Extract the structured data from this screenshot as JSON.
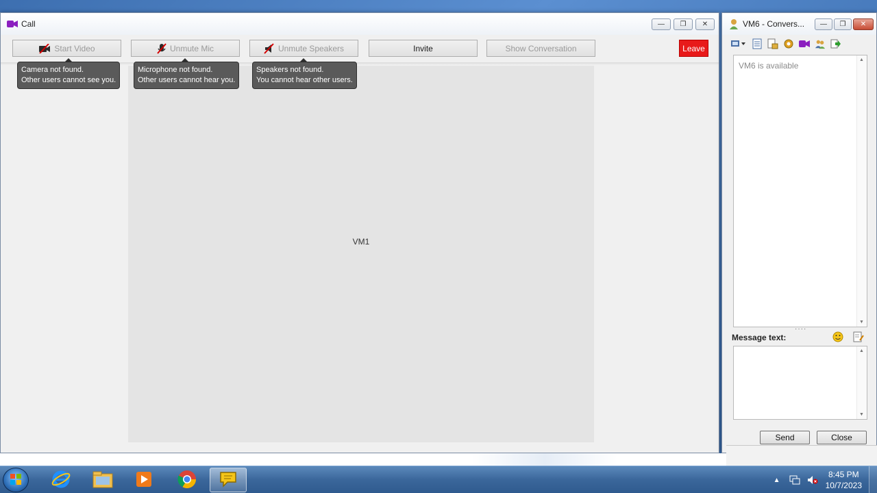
{
  "call_window": {
    "title": "Call",
    "toolbar": {
      "start_video": "Start Video",
      "unmute_mic": "Unmute Mic",
      "unmute_speakers": "Unmute Speakers",
      "invite": "Invite",
      "show_conversation": "Show Conversation",
      "leave": "Leave"
    },
    "tooltips": {
      "camera": [
        "Camera not found.",
        "Other users cannot see you."
      ],
      "microphone": [
        "Microphone not found.",
        "Other users cannot hear you."
      ],
      "speakers": [
        "Speakers not found.",
        "You cannot hear other users."
      ]
    },
    "participant": "VM1"
  },
  "conversation_window": {
    "title": "VM6 - Convers...",
    "status_text": "VM6 is available",
    "message_label": "Message text:",
    "send_label": "Send",
    "close_label": "Close",
    "toolbar_icons": [
      "view-menu-icon",
      "history-icon",
      "send-file-icon",
      "gear-icon",
      "video-call-icon",
      "add-contact-icon",
      "exit-icon"
    ]
  },
  "taskbar": {
    "items": [
      "internet-explorer-icon",
      "file-explorer-icon",
      "media-player-icon",
      "chrome-icon",
      "messenger-icon"
    ],
    "clock_time": "8:45 PM",
    "clock_date": "10/7/2023"
  },
  "colors": {
    "leave": "#e81a1a",
    "accent": "#3b679b"
  }
}
